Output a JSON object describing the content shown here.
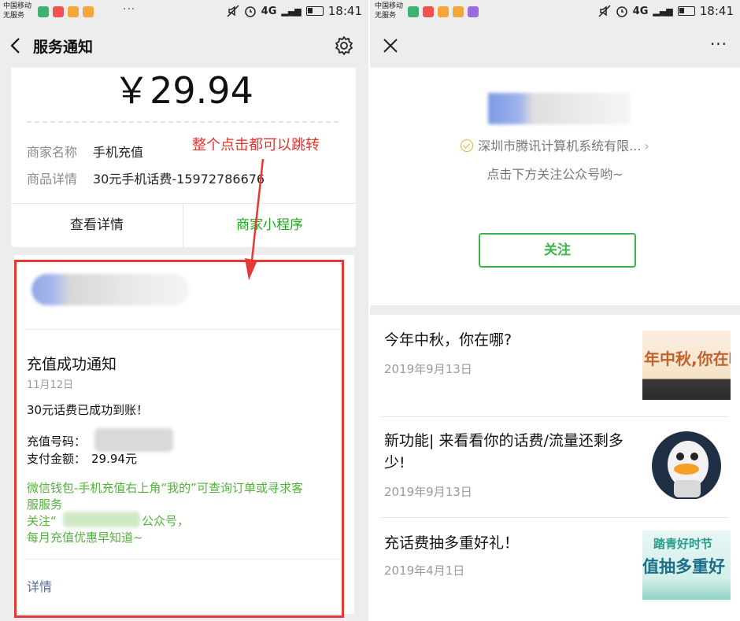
{
  "status": {
    "carrier_line1": "中国移动",
    "carrier_line2": "无服务",
    "network": "4G",
    "network2": "4G",
    "time": "18:41",
    "overflow": "···"
  },
  "left": {
    "nav_title": "服务通知",
    "amount": "￥29.94",
    "merchant_label": "商家名称",
    "merchant_value": "手机充值",
    "product_label": "商品详情",
    "product_value": "30元手机话费-15972786676",
    "view_details_button": "查看详情",
    "mini_program_button": "商家小程序",
    "annotation": "整个点击都可以跳转",
    "card": {
      "title": "充值成功通知",
      "date": "11月12日",
      "message": "30元话费已成功到账！",
      "number_label": "充值号码：",
      "amount_label": "支付金额：",
      "amount_value": "29.94元",
      "green_line1": "微信钱包-手机充值右上角“我的”可查询订单或寻求客",
      "green_line2": "服服务",
      "green_line3_prefix": "关注“",
      "green_line3_suffix": "公众号，",
      "green_line4": "每月充值优惠早知道~",
      "details_link": "详情"
    }
  },
  "right": {
    "more": "···",
    "company": "深圳市腾讯计算机系统有限...",
    "company_chevron": "›",
    "hint": "点击下方关注公众号哟~",
    "follow_button": "关注",
    "articles": [
      {
        "title": "今年中秋，你在哪?",
        "date": "2019年9月13日",
        "thumb_text": "年中秋,你在哪"
      },
      {
        "title": "新功能| 来看看你的话费/流量还剩多少!",
        "date": "2019年9月13日"
      },
      {
        "title": "充话费抽多重好礼！",
        "date": "2019年4月1日",
        "thumb_text_top": "踏青好时节",
        "thumb_text_bottom": "值抽多重好"
      }
    ]
  },
  "colors": {
    "wechat_green": "#1aad19",
    "follow_green": "#39b54a",
    "annotation_red": "#e5322d",
    "link_blue": "#576b95"
  }
}
